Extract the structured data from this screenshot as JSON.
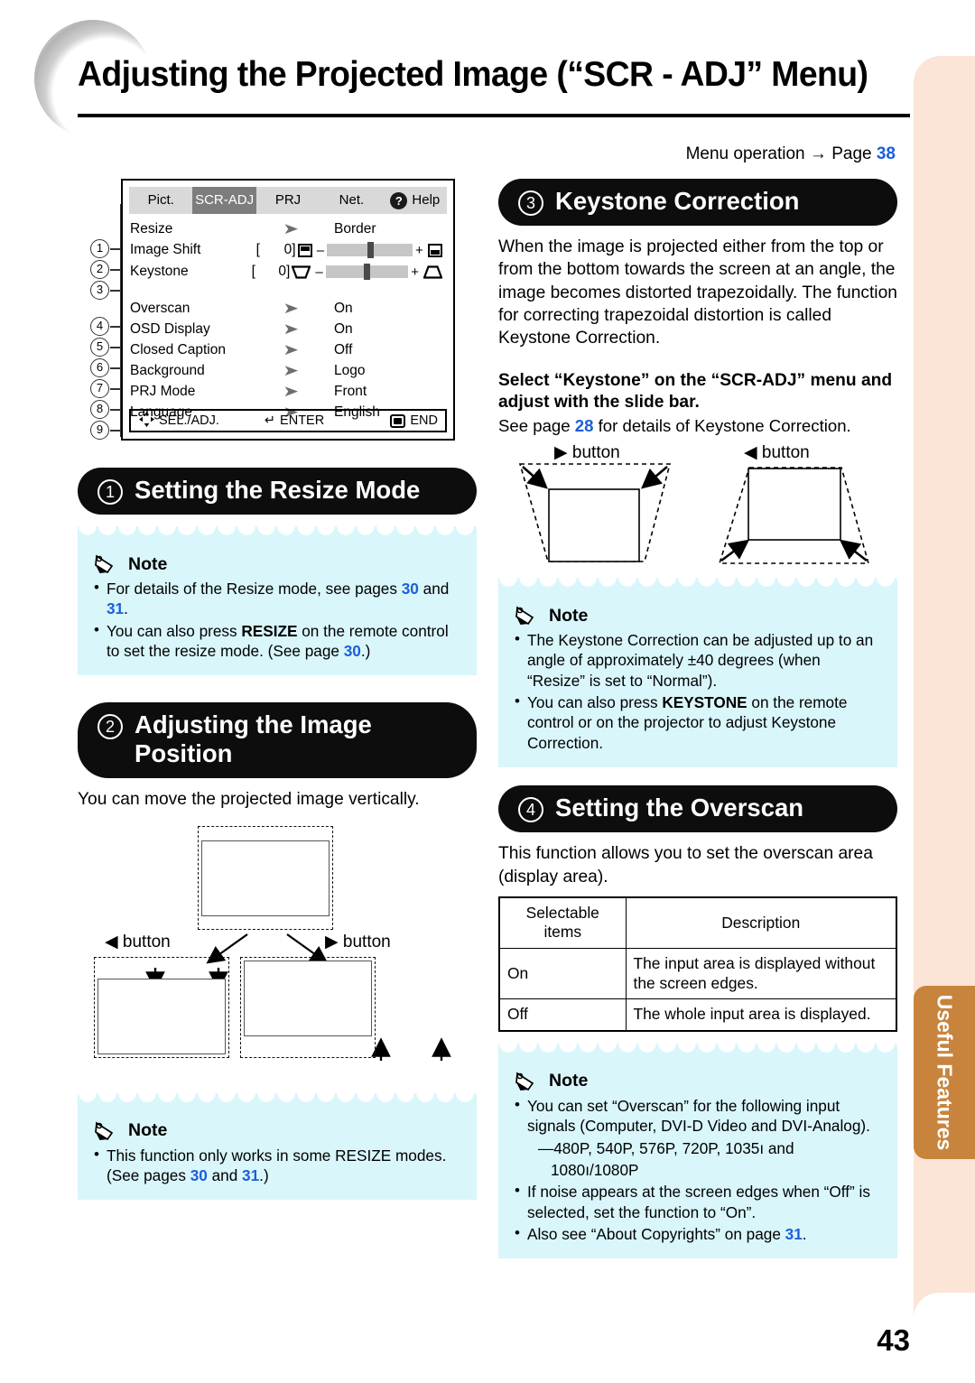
{
  "page": {
    "title": "Adjusting the Projected Image (“SCR - ADJ” Menu)",
    "menu_operation_label": "Menu operation",
    "menu_operation_arrow": "→",
    "menu_operation_page_word": "Page",
    "menu_operation_page": "38",
    "page_number": "43",
    "side_tab": "Useful Features",
    "colors": {
      "note_bg": "#d9f6fb",
      "side_tab": "#c8843c",
      "band": "#fce4d6",
      "link_blue": "#1b5fd9"
    }
  },
  "osd": {
    "tabs": [
      {
        "label": "Pict.",
        "active": false
      },
      {
        "label": "SCR-ADJ",
        "active": true
      },
      {
        "label": "PRJ",
        "active": false
      },
      {
        "label": "Net.",
        "active": false
      },
      {
        "label": "Help",
        "active": false,
        "icon": "question-mark-icon"
      }
    ],
    "numbers": [
      "1",
      "2",
      "3",
      "4",
      "5",
      "6",
      "7",
      "8",
      "9"
    ],
    "rows": [
      {
        "n": "1",
        "label": "Resize",
        "type": "arrow",
        "value": "Border"
      },
      {
        "n": "2",
        "label": "Image Shift",
        "type": "slider",
        "bracket_open": "[",
        "value": "0",
        "bracket_close": "]",
        "minus": "–",
        "plus": "+",
        "icon_left": "image-shift-top-icon",
        "icon_right": "image-shift-bottom-icon"
      },
      {
        "n": "3",
        "label": "Keystone",
        "type": "slider",
        "bracket_open": "[",
        "value": "0",
        "bracket_close": "]",
        "minus": "–",
        "plus": "+",
        "icon_left": "keystone-narrow-icon",
        "icon_right": "keystone-wide-icon"
      },
      {
        "n": "4",
        "label": "Overscan",
        "type": "arrow",
        "value": "On"
      },
      {
        "n": "5",
        "label": "OSD Display",
        "type": "arrow",
        "value": "On"
      },
      {
        "n": "6",
        "label": "Closed Caption",
        "type": "arrow",
        "value": "Off"
      },
      {
        "n": "7",
        "label": "Background",
        "type": "arrow",
        "value": "Logo"
      },
      {
        "n": "8",
        "label": "PRJ Mode",
        "type": "arrow",
        "value": "Front"
      },
      {
        "n": "9",
        "label": "Language",
        "type": "arrow",
        "value": "English"
      }
    ],
    "footer": {
      "sel": "SEL./ADJ.",
      "enter": "ENTER",
      "enter_icon": "↵",
      "end": "END"
    }
  },
  "section1": {
    "number": "1",
    "heading": "Setting the Resize Mode",
    "note_title": "Note",
    "notes": [
      {
        "html": "For details of the Resize mode, see pages <b class=\"bluenum\">30</b> and <b class=\"bluenum\">31</b>."
      },
      {
        "html": "You can also press <b>RESIZE</b> on the remote control to set the resize mode. (See page <b class=\"bluenum\">30</b>.)"
      }
    ]
  },
  "section2": {
    "number": "2",
    "heading_line1": "Adjusting the Image",
    "heading_line2": "Position",
    "body": "You can move the projected image vertically.",
    "left_button_label": "button",
    "left_button_arrow": "◀",
    "right_button_label": "button",
    "right_button_arrow": "▶",
    "note_title": "Note",
    "notes": [
      {
        "html": "This function only works in some RESIZE modes. (See pages <b class=\"bluenum\">30</b> and <b class=\"bluenum\">31</b>.)"
      }
    ]
  },
  "section3": {
    "number": "3",
    "heading": "Keystone Correction",
    "body": "When the image is projected either from the top or from the bottom towards the screen at an angle, the image becomes distorted trapezoidally. The function for correcting trapezoidal distortion is called Keystone Correction.",
    "bold_line": "Select “Keystone” on the “SCR-ADJ” menu and adjust with the slide bar.",
    "see_page_html": "See page <b class=\"bluenum\">28</b> for details of Keystone Correction.",
    "left_button_arrow": "▶",
    "left_button_label": "button",
    "right_button_arrow": "◀",
    "right_button_label": "button",
    "note_title": "Note",
    "notes": [
      {
        "html": "The Keystone Correction can be adjusted up to an angle of approximately ±40 degrees (when “Resize” is set to “Normal”)."
      },
      {
        "html": "You can also press <b>KEYSTONE</b> on the remote control or on the projector to adjust Keystone Correction."
      }
    ]
  },
  "section4": {
    "number": "4",
    "heading": "Setting the Overscan",
    "body": "This function allows you to set the overscan area (display area).",
    "table": {
      "headers": [
        "Selectable items",
        "Description"
      ],
      "rows": [
        [
          "On",
          "The input area is displayed without the screen edges."
        ],
        [
          "Off",
          "The whole input area is displayed."
        ]
      ]
    },
    "note_title": "Note",
    "notes": [
      {
        "html": "You can set “Overscan” for the following input signals (Computer, DVI-D Video and DVI-Analog)."
      },
      {
        "html": "—480P, 540P, 576P, 720P, 1035ı and",
        "nobullet": true
      },
      {
        "html": "1080ı/1080P",
        "nobullet": true,
        "indent": true
      },
      {
        "html": "If noise appears at the screen edges when “Off” is selected, set the function to “On”."
      },
      {
        "html": "Also see “About Copyrights” on page <b class=\"bluenum\">31</b>."
      }
    ]
  }
}
